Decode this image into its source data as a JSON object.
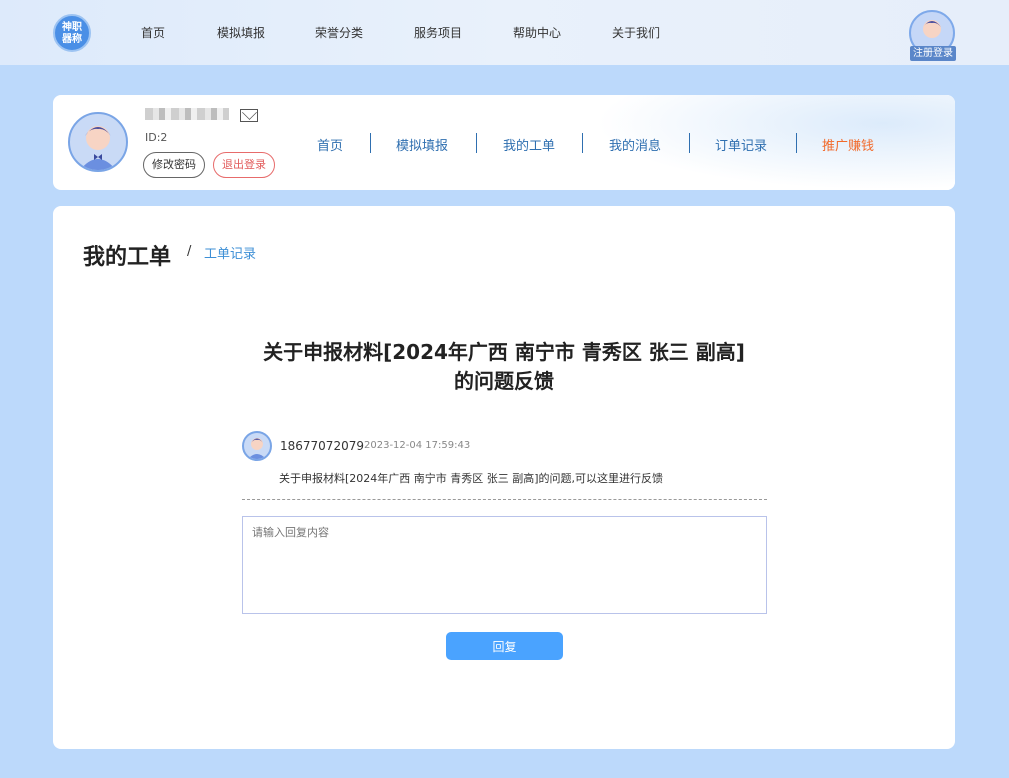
{
  "topbar": {
    "logo_text": "神职\n器称",
    "nav": [
      "首页",
      "模拟填报",
      "荣誉分类",
      "服务项目",
      "帮助中心",
      "关于我们"
    ],
    "register_label": "注册登录"
  },
  "profile": {
    "uid": "ID:2",
    "change_password": "修改密码",
    "logout": "退出登录",
    "nav": [
      "首页",
      "模拟填报",
      "我的工单",
      "我的消息",
      "订单记录"
    ],
    "promo": "推广赚钱",
    "promo_color": "#f26a2a"
  },
  "content": {
    "page_title": "我的工单",
    "crumb_sep": "/",
    "crumb": "工单记录",
    "ticket_title_line1": "关于申报材料[2024年广西 南宁市 青秀区 张三 副高]",
    "ticket_title_line2": "的问题反馈",
    "message": {
      "user": "18677072079",
      "time": "2023-12-04 17:59:43",
      "text": "关于申报材料[2024年广西 南宁市 青秀区 张三 副高]的问题,可以这里进行反馈"
    },
    "reply_placeholder": "请输入回复内容",
    "reply_button": "回复"
  }
}
